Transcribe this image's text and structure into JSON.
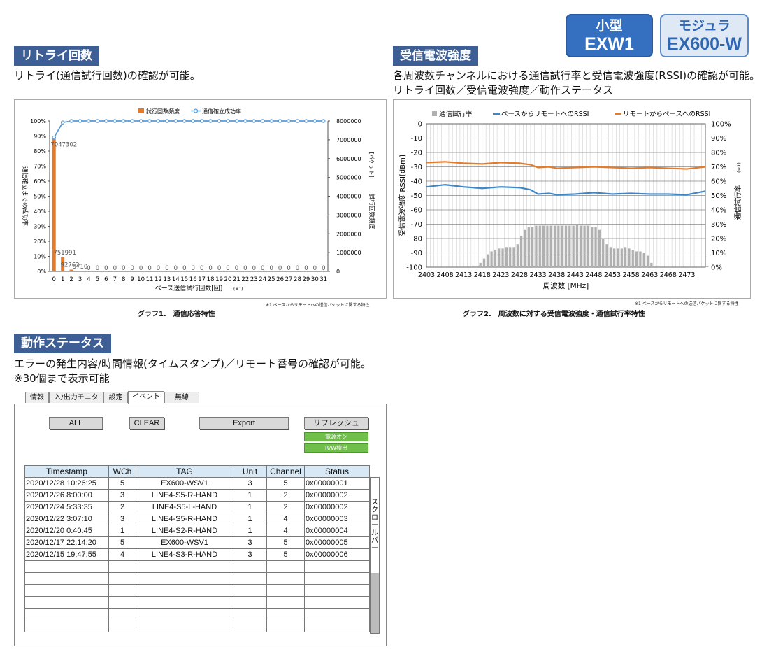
{
  "badges": {
    "exw1": {
      "line1": "小型",
      "line2": "EXW1"
    },
    "ex600": {
      "line1": "モジュラ",
      "line2": "EX600-W"
    }
  },
  "retry": {
    "heading": "リトライ回数",
    "desc": "リトライ(通信試行回数)の確認が可能。",
    "caption": "グラフ1.　通信応答特性",
    "note": "※1 ベースからリモートへの送信パケットに関する特性"
  },
  "rssi": {
    "heading": "受信電波強度",
    "desc1": "各周波数チャンネルにおける通信試行率と受信電波強度(RSSI)の確認が可能。",
    "desc2": "リトライ回数／受信電波強度／動作ステータス",
    "caption": "グラフ2.　周波数に対する受信電波強度・通信試行率特性",
    "note": "※1 ベースからリモートへの送信パケットに関する特性"
  },
  "status": {
    "heading": "動作ステータス",
    "desc1": "エラーの発生内容/時間情報(タイムスタンプ)／リモート番号の確認が可能。",
    "desc2": "※30個まで表示可能",
    "tabs": [
      "情報",
      "入/出力モニタ",
      "設定",
      "イベント",
      "無線"
    ],
    "buttons": {
      "all": "ALL",
      "clear": "CLEAR",
      "export": "Export",
      "refresh": "リフレッシュ"
    },
    "indicators": {
      "power": "電源オン",
      "rw": "R/W検出"
    },
    "table": {
      "headers": [
        "Timestamp",
        "WCh",
        "TAG",
        "Unit",
        "Channel",
        "Status"
      ],
      "rows": [
        [
          "2020/12/28 10:26:25",
          "5",
          "EX600-WSV1",
          "3",
          "5",
          "0x00000001"
        ],
        [
          "2020/12/26 8:00:00",
          "3",
          "LINE4-S5-R-HAND",
          "1",
          "2",
          "0x00000002"
        ],
        [
          "2020/12/24 5:33:35",
          "2",
          "LINE4-S5-L-HAND",
          "1",
          "2",
          "0x00000002"
        ],
        [
          "2020/12/22 3:07:10",
          "3",
          "LINE4-S5-R-HAND",
          "1",
          "4",
          "0x00000003"
        ],
        [
          "2020/12/20 0:40:45",
          "1",
          "LINE4-S2-R-HAND",
          "1",
          "4",
          "0x00000004"
        ],
        [
          "2020/12/17 22:14:20",
          "5",
          "EX600-WSV1",
          "3",
          "5",
          "0x00000005"
        ],
        [
          "2020/12/15 19:47:55",
          "4",
          "LINE4-S3-R-HAND",
          "3",
          "5",
          "0x00000006"
        ]
      ],
      "empty_rows": 6
    },
    "scrollbar_label": "スクロールバー"
  },
  "chart_data": [
    {
      "type": "bar",
      "legend": [
        "試行回数頻度",
        "通信確立成功率"
      ],
      "xlabel": "ベース送信試行回数[回]",
      "xlabel_note": "(※1)",
      "ylabel_left": "通信確立までの成功率",
      "ylabel_right": "試行回数頻度",
      "ylabel_right_unit": "[パケット]",
      "categories": [
        0,
        1,
        2,
        3,
        4,
        5,
        6,
        7,
        8,
        9,
        10,
        11,
        12,
        13,
        14,
        15,
        16,
        17,
        18,
        19,
        20,
        21,
        22,
        23,
        24,
        25,
        26,
        27,
        28,
        29,
        30,
        31
      ],
      "left_ticks": [
        "0%",
        "10%",
        "20%",
        "30%",
        "40%",
        "50%",
        "60%",
        "70%",
        "80%",
        "90%",
        "100%"
      ],
      "right_ticks": [
        "0",
        "1000000",
        "2000000",
        "3000000",
        "4000000",
        "5000000",
        "6000000",
        "7000000",
        "8000000"
      ],
      "series": [
        {
          "name": "試行回数頻度",
          "axis": "right",
          "color": "#e47b2a",
          "values": [
            7047302,
            751991,
            92762,
            5710,
            0,
            0,
            0,
            0,
            0,
            0,
            0,
            0,
            0,
            0,
            0,
            0,
            0,
            0,
            0,
            0,
            0,
            0,
            0,
            0,
            0,
            0,
            0,
            0,
            0,
            0,
            0,
            0
          ],
          "labels": [
            "7047302",
            "751991",
            "92762",
            "5710",
            "0",
            "0",
            "0",
            "0",
            "0",
            "0",
            "0",
            "0",
            "0",
            "0",
            "0",
            "0",
            "0",
            "0",
            "0",
            "0",
            "0",
            "0",
            "0",
            "0",
            "0",
            "0",
            "0",
            "0",
            "0",
            "0",
            "0",
            "0"
          ]
        },
        {
          "name": "通信確立成功率",
          "axis": "left",
          "color": "#5b9bd5",
          "values": [
            89,
            99,
            100,
            100,
            100,
            100,
            100,
            100,
            100,
            100,
            100,
            100,
            100,
            100,
            100,
            100,
            100,
            100,
            100,
            100,
            100,
            100,
            100,
            100,
            100,
            100,
            100,
            100,
            100,
            100,
            100,
            100
          ]
        }
      ],
      "ylim_left": [
        0,
        100
      ],
      "ylim_right": [
        0,
        8000000
      ]
    },
    {
      "type": "line",
      "legend": [
        "通信試行率",
        "ベースからリモートへのRSSI",
        "リモートからベースへのRSSI"
      ],
      "xlabel": "周波数 [MHz]",
      "ylabel_left": "受信電波強度 RSSI[dBm]",
      "ylabel_right": "通信試行率",
      "ylabel_right_note": "(※1)",
      "x_ticks": [
        "2403",
        "2408",
        "2413",
        "2418",
        "2423",
        "2428",
        "2433",
        "2438",
        "2443",
        "2448",
        "2453",
        "2458",
        "2463",
        "2468",
        "2473"
      ],
      "left_ticks": [
        "0",
        "-10",
        "-20",
        "-30",
        "-40",
        "-50",
        "-60",
        "-70",
        "-80",
        "-90",
        "-100"
      ],
      "right_ticks": [
        "100%",
        "90%",
        "80%",
        "70%",
        "60%",
        "50%",
        "40%",
        "30%",
        "20%",
        "10%",
        "0%"
      ],
      "xlim": [
        2403,
        2478
      ],
      "ylim_left": [
        -100,
        0
      ],
      "ylim_right": [
        0,
        100
      ],
      "series": [
        {
          "name": "通信試行率",
          "color": "#b0b0b0",
          "axis": "right",
          "x": [
            2403,
            2404,
            2405,
            2406,
            2407,
            2408,
            2409,
            2410,
            2411,
            2412,
            2413,
            2414,
            2415,
            2416,
            2417,
            2418,
            2419,
            2420,
            2421,
            2422,
            2423,
            2424,
            2425,
            2426,
            2427,
            2428,
            2429,
            2430,
            2431,
            2432,
            2433,
            2434,
            2435,
            2436,
            2437,
            2438,
            2439,
            2440,
            2441,
            2442,
            2443,
            2444,
            2445,
            2446,
            2447,
            2448,
            2449,
            2450,
            2451,
            2452,
            2453,
            2454,
            2455,
            2456,
            2457,
            2458,
            2459,
            2460,
            2461,
            2462,
            2463,
            2464,
            2465,
            2466,
            2467,
            2468,
            2469,
            2470,
            2471,
            2472,
            2473,
            2474,
            2475,
            2476,
            2477,
            2478
          ],
          "values": [
            0.5,
            0.5,
            0.5,
            0.5,
            0.5,
            0.5,
            0.5,
            0.5,
            0.5,
            0.5,
            0.5,
            0.5,
            0.8,
            1,
            3,
            6,
            9,
            11,
            12,
            13,
            13,
            14,
            14,
            14,
            16,
            22,
            26,
            28,
            28,
            29,
            29,
            29,
            29,
            29,
            29,
            29,
            29,
            29,
            29,
            29,
            30,
            29,
            29,
            29,
            28,
            28,
            26,
            20,
            16,
            14,
            13,
            13,
            13,
            14,
            13,
            12,
            11,
            11,
            10,
            8,
            3,
            1,
            0.5,
            0.5,
            0.5,
            0.5,
            0.5,
            0.5,
            0.5,
            0.5,
            0.5,
            0.5,
            0.5,
            0.5,
            0.5,
            0.5
          ]
        },
        {
          "name": "ベースからリモートへのRSSI",
          "color": "#3f86c7",
          "axis": "left",
          "x": [
            2403,
            2408,
            2413,
            2418,
            2423,
            2428,
            2431,
            2433,
            2436,
            2438,
            2443,
            2448,
            2453,
            2458,
            2463,
            2468,
            2473,
            2478
          ],
          "values": [
            -44,
            -42.5,
            -44,
            -45,
            -44,
            -44.5,
            -46,
            -49,
            -48.5,
            -49.5,
            -49,
            -48,
            -49,
            -48.5,
            -49,
            -49,
            -49.5,
            -47
          ]
        },
        {
          "name": "リモートからベースへのRSSI",
          "color": "#e47b2a",
          "axis": "left",
          "x": [
            2403,
            2408,
            2413,
            2418,
            2423,
            2428,
            2431,
            2433,
            2436,
            2438,
            2443,
            2448,
            2453,
            2458,
            2463,
            2468,
            2473,
            2478
          ],
          "values": [
            -27,
            -26.5,
            -27.5,
            -28,
            -27,
            -27.5,
            -28.5,
            -30.5,
            -30,
            -31,
            -30.5,
            -30,
            -30.5,
            -31,
            -30.5,
            -31,
            -31.5,
            -30
          ]
        }
      ]
    }
  ]
}
